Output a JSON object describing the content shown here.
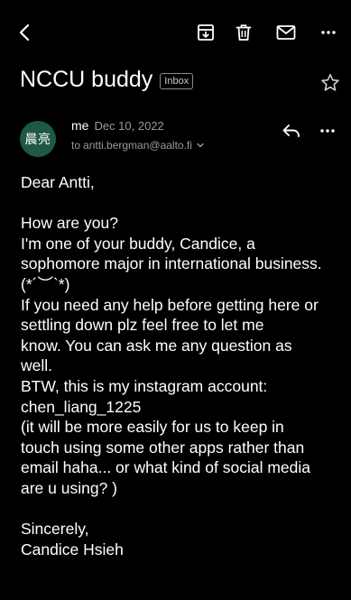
{
  "toolbar": {
    "back_icon": "chevron-left-icon",
    "archive_icon": "archive-icon",
    "delete_icon": "trash-icon",
    "mark_unread_icon": "mail-icon",
    "more_icon": "more-horizontal-icon"
  },
  "email": {
    "subject": "NCCU buddy",
    "label": "Inbox",
    "star_icon": "star-outline-icon",
    "sender": {
      "avatar_text": "晨亮",
      "avatar_color": "#1e5a43",
      "name": "me",
      "date": "Dec 10, 2022",
      "to_prefix": "to",
      "recipient": "antti.bergman@aalto.fi",
      "details_icon": "chevron-down-icon"
    },
    "reply_icon": "reply-icon",
    "more_icon": "more-horizontal-icon",
    "body": {
      "greeting": "Dear Antti,",
      "lines": [
        "How are you?",
        "I'm one of your buddy, Candice, a",
        "sophomore major in international business.",
        "(*´︶`*)",
        "If you need any help before getting here or",
        "settling down plz feel free to let me",
        "know. You can ask me any question as",
        "well.",
        "BTW, this is my instagram account:",
        "chen_liang_1225",
        "(it will be more easily for us to keep in",
        "touch using some other apps rather than",
        "email haha... or what kind of social media",
        "are u using? )"
      ],
      "closing": "Sincerely,",
      "signature": "Candice Hsieh"
    }
  }
}
